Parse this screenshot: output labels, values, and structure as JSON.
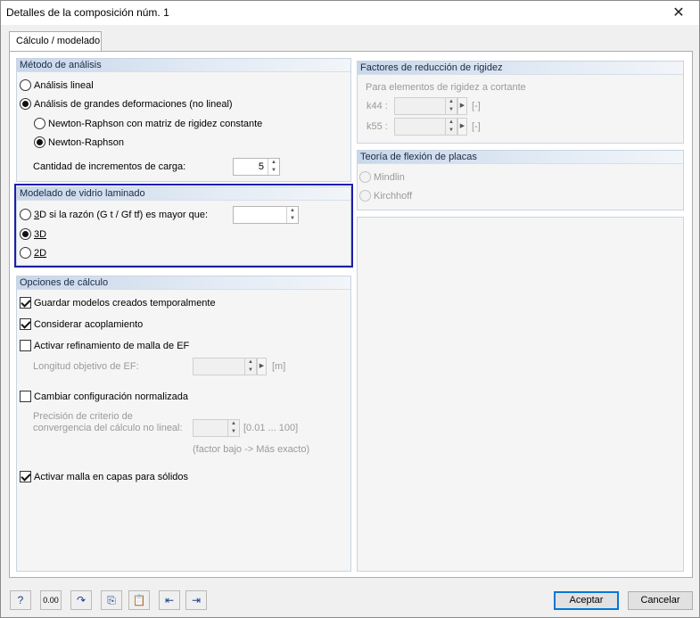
{
  "window": {
    "title": "Detalles de la composición núm. 1",
    "close_glyph": "✕"
  },
  "tabs": [
    {
      "label": "Cálculo / modelado",
      "active": true
    }
  ],
  "analysis_method": {
    "title": "Método de análisis",
    "linear": "Análisis lineal",
    "large_deformation": "Análisis de grandes deformaciones (no lineal)",
    "newton_const": "Newton-Raphson con matriz de rigidez constante",
    "newton": "Newton-Raphson",
    "load_increments_label": "Cantidad de incrementos de carga:",
    "load_increments_value": "5",
    "selected": "large_deformation",
    "sub_selected": "newton"
  },
  "laminated_glass": {
    "title": "Modelado de vidrio laminado",
    "option_ratio_prefix": "3",
    "option_ratio_rest": "D si la razón (G t / Gf tf) es mayor que:",
    "option_ratio_value": "",
    "option_3d": "3D",
    "option_2d": "2D",
    "selected": "3d"
  },
  "calc_options": {
    "title": "Opciones de cálculo",
    "save_temp_models": "Guardar modelos creados temporalmente",
    "save_temp_models_checked": true,
    "coupling": "Considerar acoplamiento",
    "coupling_checked": true,
    "mesh_refinement": "Activar refinamiento de malla de EF",
    "mesh_refinement_checked": false,
    "fe_target_length_label": "Longitud objetivo de EF:",
    "fe_target_length_value": "",
    "fe_target_length_unit": "[m]",
    "change_standard_config": "Cambiar configuración normalizada",
    "change_standard_config_checked": false,
    "precision_label_1": "Precisión de criterio de",
    "precision_label_2": "convergencia del cálculo no lineal:",
    "precision_value": "",
    "precision_range": "[0.01 ... 100]",
    "precision_hint": "(factor bajo -> Más exacto)",
    "layered_mesh": "Activar malla en capas para sólidos",
    "layered_mesh_checked": true
  },
  "stiffness_reduction": {
    "title": "Factores de reducción de rigidez",
    "subtitle": "Para elementos de rigidez a cortante",
    "k44_label": "k44 :",
    "k55_label": "k55 :",
    "unit": "[-]"
  },
  "plate_theory": {
    "title": "Teoría de flexión de placas",
    "mindlin": "Mindlin",
    "kirchhoff": "Kirchhoff"
  },
  "toolbar": {
    "icons": [
      "help-icon",
      "units-icon",
      "reset-icon",
      "copy-icon",
      "paste-icon",
      "import-icon",
      "export-icon"
    ],
    "units_label": "0.00"
  },
  "buttons": {
    "ok": "Aceptar",
    "cancel": "Cancelar"
  }
}
